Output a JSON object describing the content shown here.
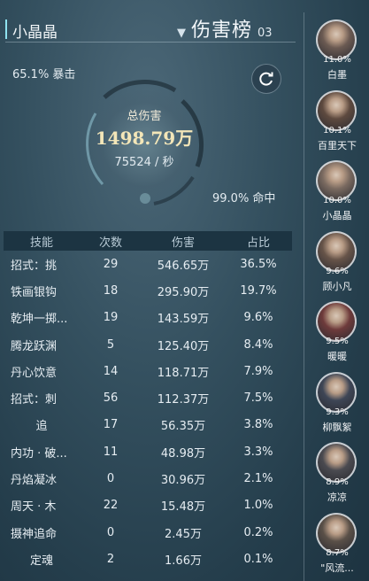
{
  "header": {
    "player_name": "小晶晶",
    "rank_title": "伤害榜",
    "page": "03",
    "dropdown_glyph": "▼"
  },
  "stats": {
    "crit": "65.1% 暴击",
    "total_label": "总伤害",
    "total_value": "1498.79万",
    "dps": "75524 / 秒",
    "hit": "99.0% 命中"
  },
  "table": {
    "headers": [
      "技能",
      "次数",
      "伤害",
      "占比"
    ],
    "rows": [
      [
        "招式：挑",
        "29",
        "546.65万",
        "36.5%"
      ],
      [
        "铁画银钩",
        "18",
        "295.90万",
        "19.7%"
      ],
      [
        "乾坤一掷...",
        "19",
        "143.59万",
        "9.6%"
      ],
      [
        "腾龙跃渊",
        "5",
        "125.40万",
        "8.4%"
      ],
      [
        "丹心饮意",
        "14",
        "118.71万",
        "7.9%"
      ],
      [
        "招式：刺",
        "56",
        "112.37万",
        "7.5%"
      ],
      [
        "追",
        "17",
        "56.35万",
        "3.8%"
      ],
      [
        "内功 · 破...",
        "11",
        "48.98万",
        "3.3%"
      ],
      [
        "丹焰凝冰",
        "0",
        "30.96万",
        "2.1%"
      ],
      [
        "周天 · 木",
        "22",
        "15.48万",
        "1.0%"
      ],
      [
        "摄神追命",
        "0",
        "2.45万",
        "0.2%"
      ],
      [
        "定魂",
        "2",
        "1.66万",
        "0.1%"
      ]
    ]
  },
  "players": [
    {
      "name": "白墨",
      "pct": "11.0%",
      "color": "#6b5a52"
    },
    {
      "name": "百里天下",
      "pct": "10.1%",
      "color": "#5e4a3f"
    },
    {
      "name": "小晶晶",
      "pct": "10.0%",
      "color": "#7a6a60"
    },
    {
      "name": "顾小凡",
      "pct": "9.6%",
      "color": "#675449"
    },
    {
      "name": "暖暖",
      "pct": "9.5%",
      "color": "#6e3b3b"
    },
    {
      "name": "柳飘絮",
      "pct": "9.3%",
      "color": "#3e4656"
    },
    {
      "name": "凉凉",
      "pct": "8.9%",
      "color": "#4a4a50"
    },
    {
      "name": "\"风流...",
      "pct": "8.7%",
      "color": "#5a5048"
    }
  ],
  "icons": {
    "refresh": "refresh-icon"
  }
}
